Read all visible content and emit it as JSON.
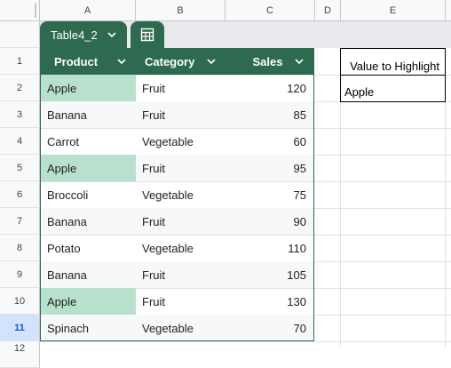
{
  "columns": [
    "A",
    "B",
    "C",
    "D",
    "E"
  ],
  "rows": [
    "1",
    "2",
    "3",
    "4",
    "5",
    "6",
    "7",
    "8",
    "9",
    "10",
    "11",
    "12"
  ],
  "selected_row": "11",
  "table": {
    "name": "Table4_2",
    "header_color": "#2d6a4f",
    "highlight_color": "#b7e1cd",
    "headers": [
      "Product",
      "Category",
      "Sales"
    ],
    "rows": [
      {
        "product": "Apple",
        "category": "Fruit",
        "sales": "120",
        "highlight": true
      },
      {
        "product": "Banana",
        "category": "Fruit",
        "sales": "85",
        "highlight": false
      },
      {
        "product": "Carrot",
        "category": "Vegetable",
        "sales": "60",
        "highlight": false
      },
      {
        "product": "Apple",
        "category": "Fruit",
        "sales": "95",
        "highlight": true
      },
      {
        "product": "Broccoli",
        "category": "Vegetable",
        "sales": "75",
        "highlight": false
      },
      {
        "product": "Banana",
        "category": "Fruit",
        "sales": "90",
        "highlight": false
      },
      {
        "product": "Potato",
        "category": "Vegetable",
        "sales": "110",
        "highlight": false
      },
      {
        "product": "Banana",
        "category": "Fruit",
        "sales": "105",
        "highlight": false
      },
      {
        "product": "Apple",
        "category": "Fruit",
        "sales": "130",
        "highlight": true
      },
      {
        "product": "Spinach",
        "category": "Vegetable",
        "sales": "70",
        "highlight": false
      }
    ]
  },
  "highlight_box": {
    "label": "Value to Highlight",
    "value": "Apple"
  },
  "icons": {
    "table_dropdown": "chevron-down-icon",
    "table_menu": "table-icon",
    "column_filter": "chevron-down-icon"
  }
}
